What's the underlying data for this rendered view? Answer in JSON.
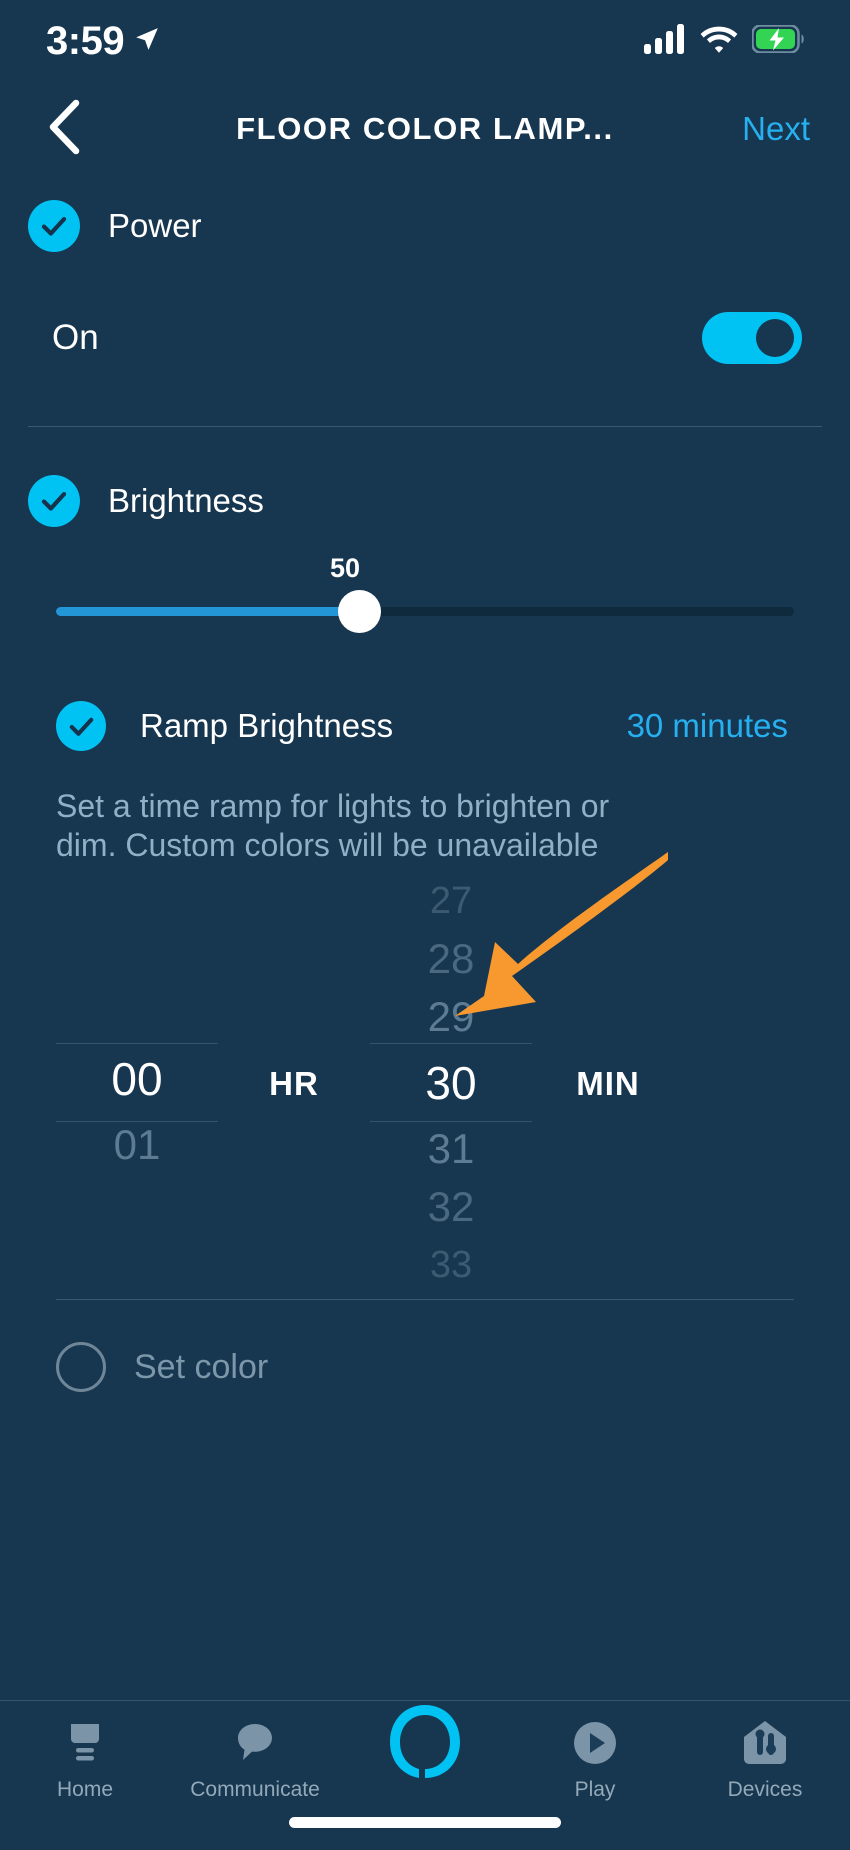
{
  "status_bar": {
    "time": "3:59",
    "location_icon": "location-arrow-icon",
    "cellular_icon": "cellular-signal-icon",
    "wifi_icon": "wifi-icon",
    "battery_icon": "battery-charging-icon",
    "battery_color": "#33d353"
  },
  "nav": {
    "back_icon": "chevron-left-icon",
    "title": "FLOOR COLOR LAMP...",
    "next_label": "Next"
  },
  "power": {
    "label": "Power",
    "checked_icon": "check-circle-icon",
    "state_label": "On",
    "toggle_on": true
  },
  "brightness": {
    "label": "Brightness",
    "checked_icon": "check-circle-icon",
    "value": "50",
    "min": "0",
    "max": "100"
  },
  "ramp": {
    "label": "Ramp Brightness",
    "checked_icon": "check-circle-icon",
    "value_label": "30 minutes",
    "description": "Set a time ramp for lights to brighten or dim. Custom colors will be unavailable",
    "hour_unit": "HR",
    "minute_unit": "MIN",
    "hours": {
      "above": [
        "",
        "",
        ""
      ],
      "selected": "00",
      "below": [
        "01",
        "",
        ""
      ]
    },
    "minutes": {
      "above": [
        "27",
        "28",
        "29"
      ],
      "selected": "30",
      "below": [
        "31",
        "32",
        "33"
      ]
    }
  },
  "set_color": {
    "label": "Set color",
    "unchecked_icon": "circle-outline-icon",
    "checked": false
  },
  "annotation": {
    "arrow_icon": "arrow-pointer-icon",
    "arrow_color": "#F7992E"
  },
  "tabbar": {
    "items": [
      {
        "label": "Home",
        "icon": "home-icon",
        "active": false
      },
      {
        "label": "Communicate",
        "icon": "speech-bubble-icon",
        "active": false
      },
      {
        "label": "",
        "icon": "alexa-ring-icon",
        "active": true
      },
      {
        "label": "Play",
        "icon": "play-circle-icon",
        "active": false
      },
      {
        "label": "Devices",
        "icon": "devices-icon",
        "active": false
      }
    ]
  },
  "colors": {
    "background": "#17364f",
    "accent_cyan": "#00c2f3",
    "link_blue": "#27b0f0",
    "muted_text": "#8fb0c6"
  }
}
